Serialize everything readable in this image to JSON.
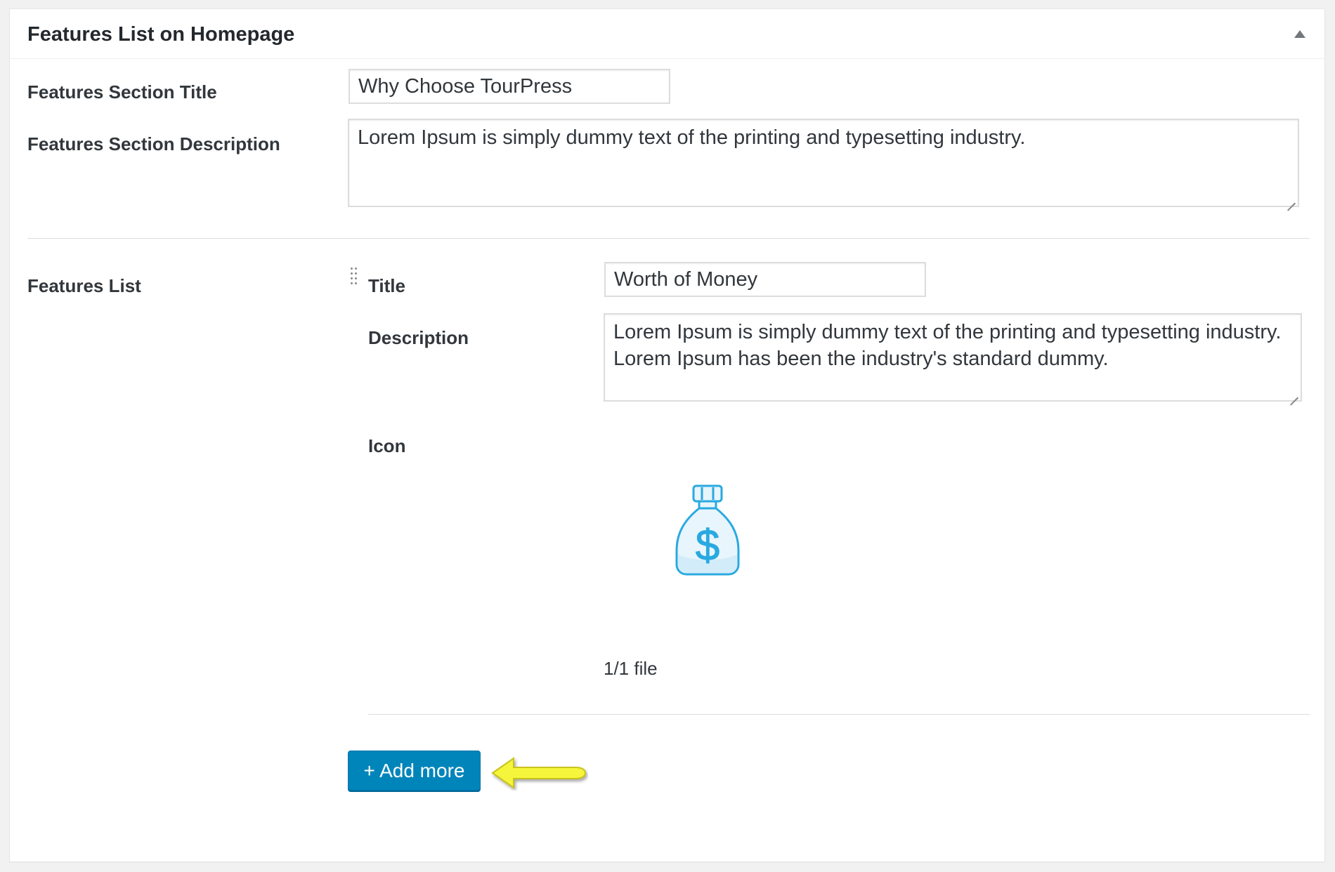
{
  "panel": {
    "title": "Features List on Homepage",
    "toggle_icon": "triangle-up-icon"
  },
  "section_title": {
    "label": "Features Section Title",
    "value": "Why Choose TourPress"
  },
  "section_description": {
    "label": "Features Section Description",
    "value": "Lorem Ipsum is simply dummy text of the printing and typesetting industry."
  },
  "features_list": {
    "label": "Features List",
    "drag_icon": "drag-handle-icon",
    "item": {
      "title_label": "Title",
      "title_value": "Worth of Money",
      "description_label": "Description",
      "description_value": "Lorem Ipsum is simply dummy text of the printing and typesetting industry. Lorem Ipsum has been the industry's standard dummy.",
      "icon_label": "Icon",
      "icon_image": "money-bag-icon",
      "file_count": "1/1 file"
    },
    "add_button_label": "+ Add more",
    "annotation_icon": "yellow-arrow-icon"
  },
  "colors": {
    "button_blue": "#0085ba",
    "icon_blue": "#29a9e1",
    "arrow_yellow": "#f5f53a"
  }
}
